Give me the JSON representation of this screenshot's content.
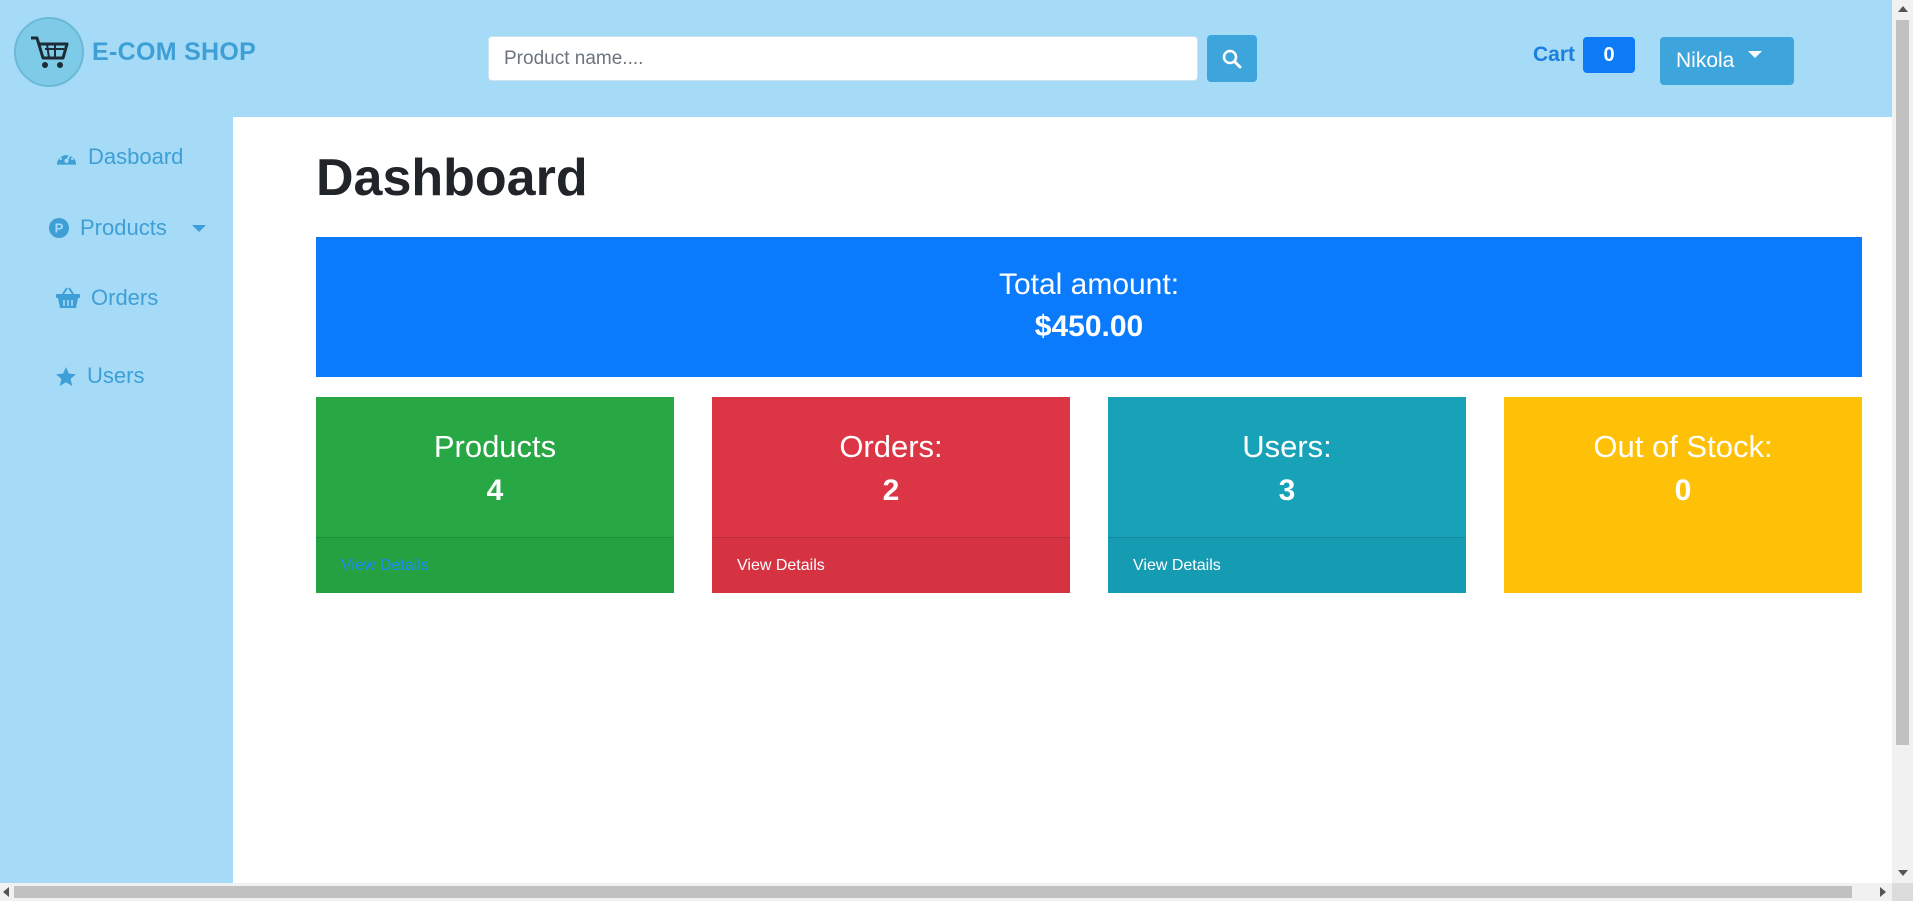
{
  "brand": {
    "name": "E-COM SHOP",
    "logo_icon": "shopping-cart-icon"
  },
  "search": {
    "placeholder": "Product name....",
    "value": "",
    "button_icon": "search-icon"
  },
  "cart": {
    "label": "Cart",
    "count": "0"
  },
  "user": {
    "name": "Nikola"
  },
  "sidebar": {
    "items": [
      {
        "label": "Dasboard",
        "icon": "dashboard-gauge-icon"
      },
      {
        "label": "Products",
        "icon": "product-p-icon"
      },
      {
        "label": "Orders",
        "icon": "basket-icon"
      },
      {
        "label": "Users",
        "icon": "star-icon"
      }
    ]
  },
  "main": {
    "title": "Dashboard",
    "total": {
      "label": "Total amount:",
      "value": "$450.00"
    },
    "cards": [
      {
        "title": "Products",
        "value": "4",
        "footer": "View Details"
      },
      {
        "title": "Orders:",
        "value": "2",
        "footer": "View Details"
      },
      {
        "title": "Users:",
        "value": "3",
        "footer": "View Details"
      },
      {
        "title": "Out of Stock:",
        "value": "0"
      }
    ]
  },
  "colors": {
    "header_bg": "#a5dbf7",
    "accent": "#3ea4dc",
    "primary": "#0a7bfd",
    "success": "#28a745",
    "danger": "#dc3545",
    "info": "#17a2b8",
    "warning": "#ffc107"
  }
}
